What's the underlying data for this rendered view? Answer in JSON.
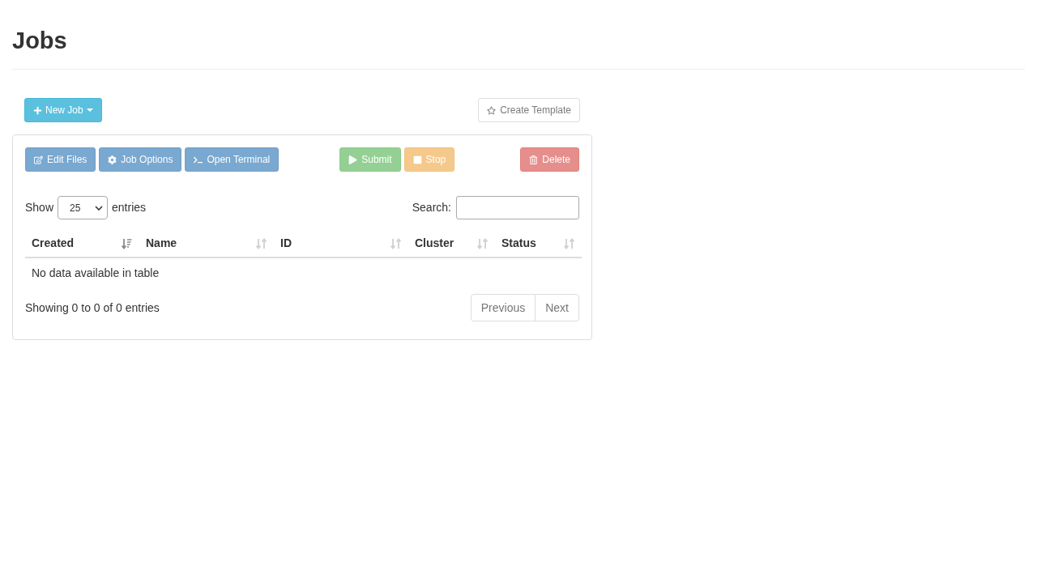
{
  "page_title": "Jobs",
  "actions": [
    {
      "label": "New Job",
      "kind": "new",
      "disabled": false
    },
    {
      "label": "Create Template",
      "kind": "template",
      "disabled": true
    }
  ],
  "panel": {
    "toolbar": [
      {
        "label": "Edit Files",
        "kind": "edit",
        "disabled": true
      },
      {
        "label": "Job Options",
        "kind": "options",
        "disabled": true
      },
      {
        "label": "Open Terminal",
        "kind": "terminal",
        "disabled": true
      },
      {
        "label": "Submit",
        "kind": "submit",
        "disabled": true
      },
      {
        "label": "Stop",
        "kind": "stop",
        "disabled": true
      },
      {
        "label": "Delete",
        "kind": "delete",
        "disabled": true
      }
    ],
    "length_menu": {
      "label_before": "Show",
      "value": "25",
      "label_after": "entries"
    },
    "search": {
      "label": "Search:"
    },
    "table": {
      "columns": [
        {
          "label": "Created",
          "sorted": true
        },
        {
          "label": "Name",
          "sorted": false
        },
        {
          "label": "ID",
          "sorted": false
        },
        {
          "label": "Cluster",
          "sorted": false
        },
        {
          "label": "Status",
          "sorted": false
        }
      ],
      "empty_message": "No data available in table"
    },
    "info": "Showing 0 to 0 of 0 entries",
    "pagination": [
      {
        "label": "Previous",
        "disabled": true
      },
      {
        "label": "Next",
        "disabled": true
      }
    ]
  }
}
